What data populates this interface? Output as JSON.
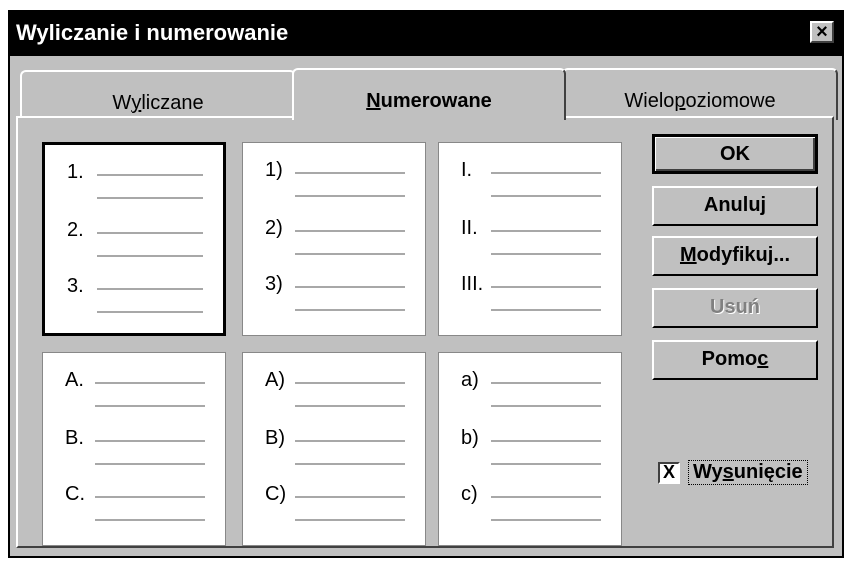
{
  "dialog": {
    "title": "Wyliczanie i numerowanie",
    "close_glyph": "×"
  },
  "tabs": [
    {
      "pre": "W",
      "key": "y",
      "post": "liczane"
    },
    {
      "pre": "",
      "key": "N",
      "post": "umerowane"
    },
    {
      "pre": "Wielo",
      "key": "p",
      "post": "oziomowe"
    }
  ],
  "presets": [
    {
      "markers": [
        "1.",
        "2.",
        "3."
      ]
    },
    {
      "markers": [
        "1)",
        "2)",
        "3)"
      ]
    },
    {
      "markers": [
        "I.",
        "II.",
        "III."
      ]
    },
    {
      "markers": [
        "A.",
        "B.",
        "C."
      ]
    },
    {
      "markers": [
        "A)",
        "B)",
        "C)"
      ]
    },
    {
      "markers": [
        "a)",
        "b)",
        "c)"
      ]
    }
  ],
  "buttons": {
    "ok": "OK",
    "cancel": "Anuluj",
    "modify_key": "M",
    "modify_rest": "odyfikuj...",
    "delete": "Usuń",
    "help_pre": "Pomo",
    "help_key": "c"
  },
  "indent": {
    "checked_glyph": "X",
    "pre": "Wy",
    "key": "s",
    "post": "unięcie"
  },
  "colors": {
    "titlebar": "#000000",
    "face": "#c0c0c0"
  }
}
